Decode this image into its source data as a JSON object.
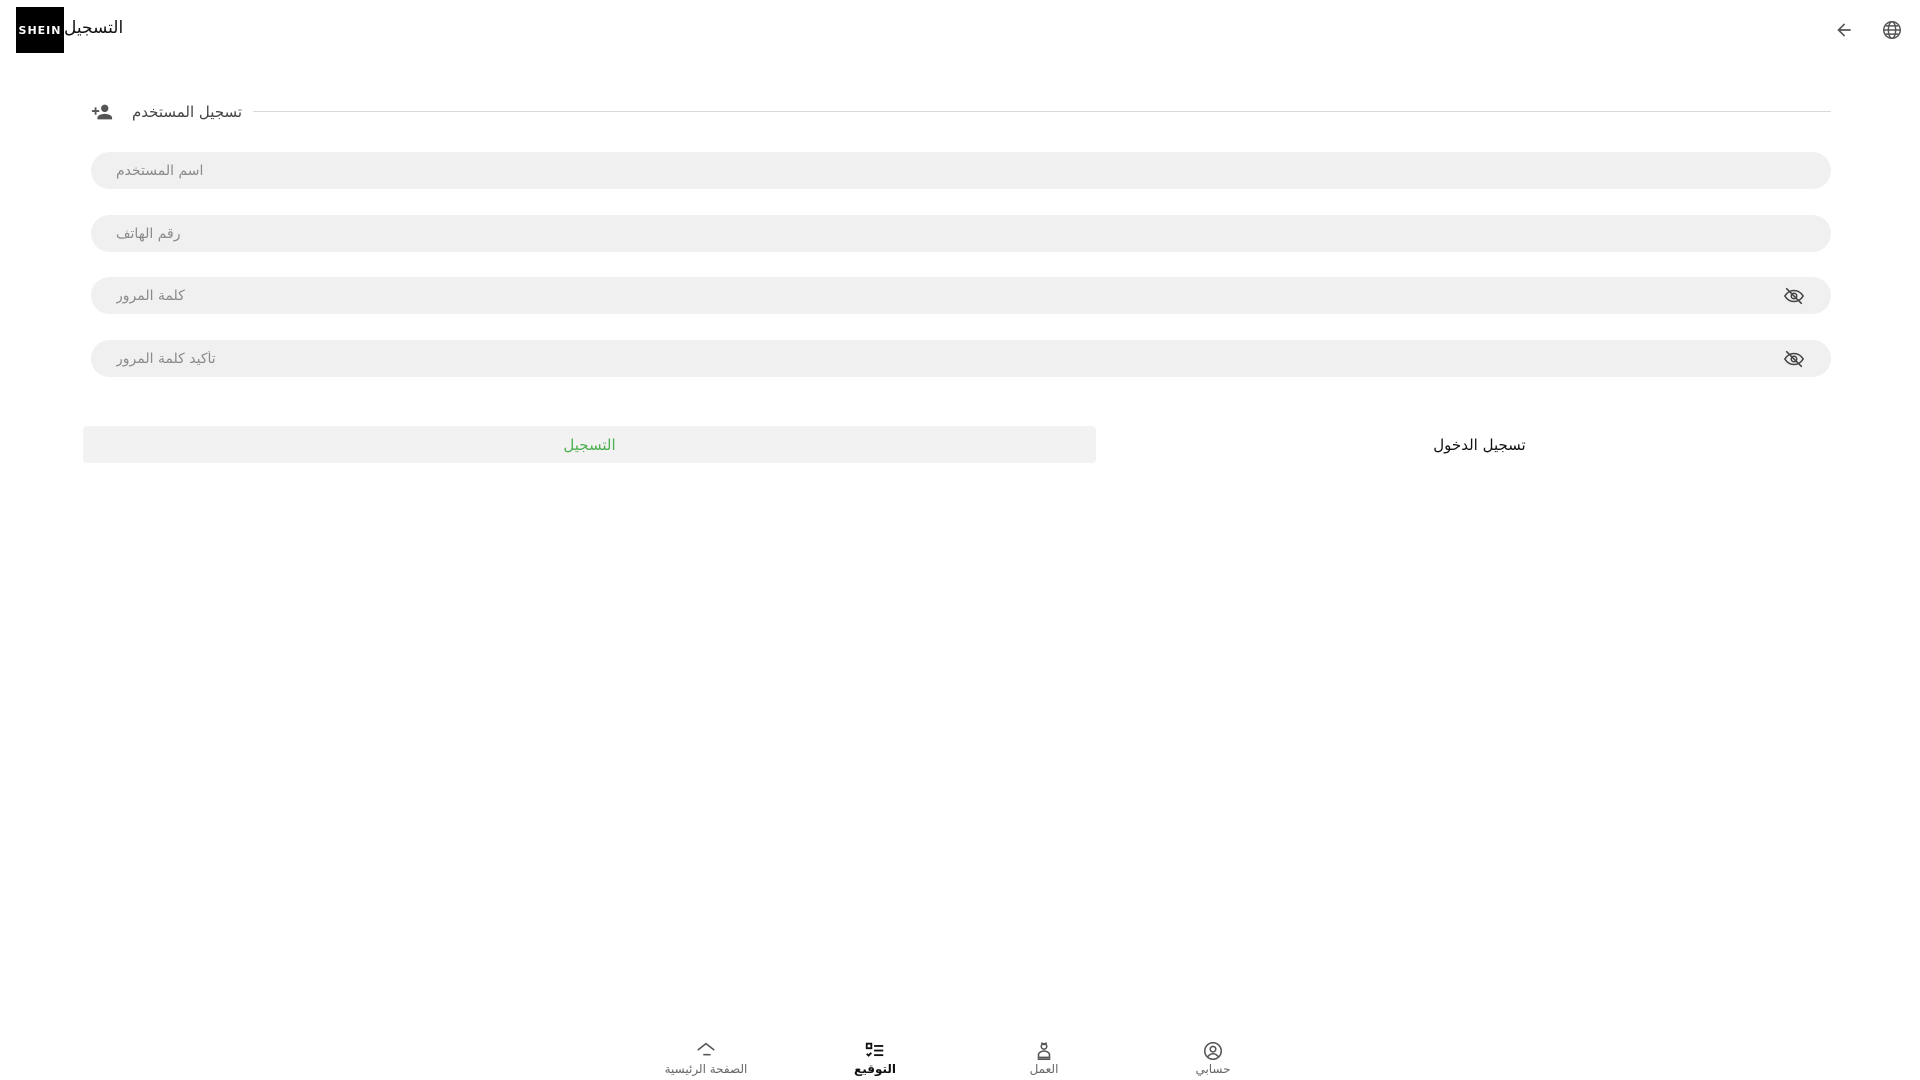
{
  "header": {
    "logo_text": "SHEIN",
    "title": "التسجيل",
    "back_icon": "arrow-back-icon",
    "language_icon": "globe-icon"
  },
  "section": {
    "title": "تسجيل المستخدم",
    "icon": "person-add-icon"
  },
  "form": {
    "username": {
      "value": "",
      "placeholder": "اسم المستخدم"
    },
    "phone": {
      "value": "",
      "placeholder": "رقم الهاتف"
    },
    "password": {
      "value": "",
      "placeholder": "كلمة المرور",
      "visibility_icon": "eye-off-icon"
    },
    "confirm_password": {
      "value": "",
      "placeholder": "تأكيد كلمة المرور",
      "visibility_icon": "eye-off-icon"
    }
  },
  "actions": {
    "register_label": "التسجيل",
    "login_label": "تسجيل الدخول"
  },
  "bottom_nav": {
    "items": [
      {
        "label": "الصفحة الرئيسية",
        "icon": "home-icon",
        "active": false
      },
      {
        "label": "التوقيع",
        "icon": "checklist-icon",
        "active": true
      },
      {
        "label": "العمل",
        "icon": "work-icon",
        "active": false
      },
      {
        "label": "حسابي",
        "icon": "account-circle-icon",
        "active": false
      }
    ]
  },
  "colors": {
    "accent_green": "#4caf50",
    "field_background": "#f0f0f0",
    "logo_background": "#000000"
  }
}
